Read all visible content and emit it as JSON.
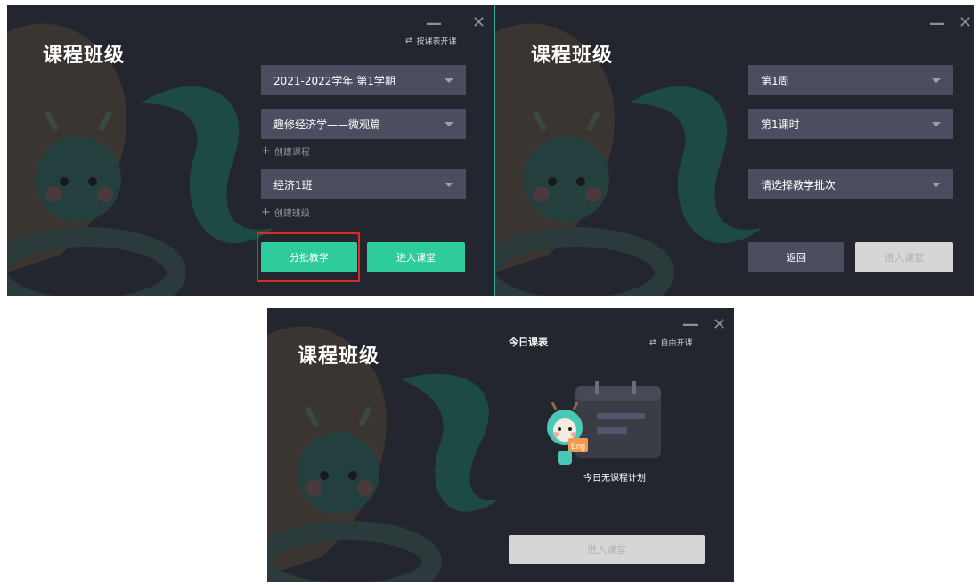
{
  "panel1": {
    "title": "课程班级",
    "switch_label": "按课表开课",
    "semester": "2021-2022学年 第1学期",
    "course": "趣修经济学——微观篇",
    "create_course": "创建课程",
    "class": "经济1班",
    "create_class": "创建班级",
    "batch_button": "分批教学",
    "enter_button": "进入课堂"
  },
  "panel2": {
    "title": "课程班级",
    "week": "第1周",
    "period": "第1课时",
    "batch_select": "请选择教学批次",
    "back_button": "返回",
    "enter_button": "进入课堂"
  },
  "panel3": {
    "title": "课程班级",
    "today_schedule": "今日课表",
    "switch_label": "自由开课",
    "empty_text": "今日无课程计划",
    "mascot_badge": "Eng",
    "enter_button": "进入课堂"
  },
  "colors": {
    "panel_bg": "#23262e",
    "select_bg": "#4b4e5e",
    "accent_green": "#2ecc9a",
    "highlight_red": "#e02828"
  }
}
